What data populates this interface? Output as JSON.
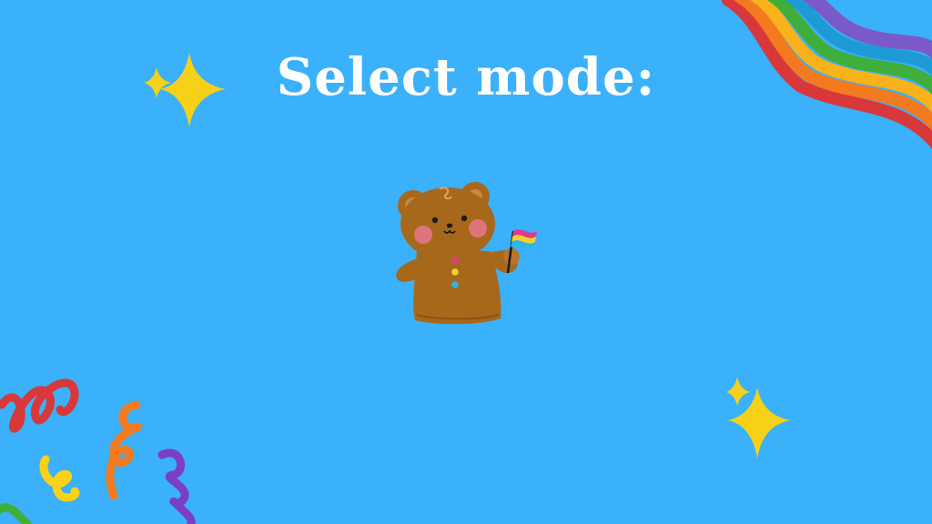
{
  "screen": {
    "title": "Select mode:"
  },
  "colors": {
    "background": "#3bb0fb",
    "title": "#ffffff",
    "sparkle": "#f7d117",
    "bear_fur": "#a8681c",
    "rainbow": [
      "#d9383a",
      "#f47a1f",
      "#f9b21a",
      "#3fae3b",
      "#1e9bd7",
      "#7a59c9"
    ],
    "bi_flag": [
      "#e03a8f",
      "#f3d02a",
      "#2ab6e8"
    ]
  },
  "icons": [
    "sparkle-icon",
    "bear-with-flag-icon",
    "rainbow-wave-icon",
    "confetti-swirl-icon"
  ]
}
